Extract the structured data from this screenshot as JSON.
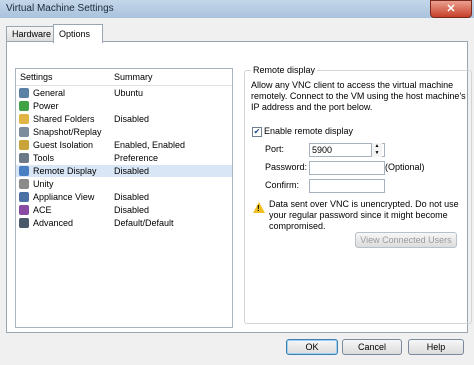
{
  "window": {
    "title": "Virtual Machine Settings",
    "close_label": "✕"
  },
  "tabs": [
    {
      "label": "Hardware",
      "active": false
    },
    {
      "label": "Options",
      "active": true
    }
  ],
  "settings_list": {
    "headers": {
      "settings": "Settings",
      "summary": "Summary"
    },
    "items": [
      {
        "name": "General",
        "summary": "Ubuntu",
        "icon": "general-icon"
      },
      {
        "name": "Power",
        "summary": "",
        "icon": "power-icon"
      },
      {
        "name": "Shared Folders",
        "summary": "Disabled",
        "icon": "folder-icon"
      },
      {
        "name": "Snapshot/Replay",
        "summary": "",
        "icon": "snapshot-icon"
      },
      {
        "name": "Guest Isolation",
        "summary": "Enabled, Enabled",
        "icon": "lock-icon"
      },
      {
        "name": "Tools",
        "summary": "Preference",
        "icon": "tools-icon"
      },
      {
        "name": "Remote Display",
        "summary": "Disabled",
        "icon": "monitor-icon",
        "selected": true
      },
      {
        "name": "Unity",
        "summary": "",
        "icon": "unity-icon"
      },
      {
        "name": "Appliance View",
        "summary": "Disabled",
        "icon": "appliance-icon"
      },
      {
        "name": "ACE",
        "summary": "Disabled",
        "icon": "ace-icon"
      },
      {
        "name": "Advanced",
        "summary": "Default/Default",
        "icon": "advanced-icon"
      }
    ]
  },
  "remote_display": {
    "legend": "Remote display",
    "description": "Allow any VNC client to access the virtual machine remotely. Connect to the VM using the host machine's IP address and the port below.",
    "enable_label": "Enable remote display",
    "enable_checked": true,
    "port_label": "Port:",
    "port_value": "5900",
    "password_label": "Password:",
    "password_value": "",
    "optional_label": "(Optional)",
    "confirm_label": "Confirm:",
    "confirm_value": "",
    "warning": "Data sent over VNC is unencrypted. Do not use your regular password since it might become compromised.",
    "view_connected_users_label": "View Connected Users"
  },
  "buttons": {
    "ok": "OK",
    "cancel": "Cancel",
    "help": "Help"
  },
  "colors": {
    "selected_row": "#d8e6f6",
    "warning": "#f0c020"
  }
}
